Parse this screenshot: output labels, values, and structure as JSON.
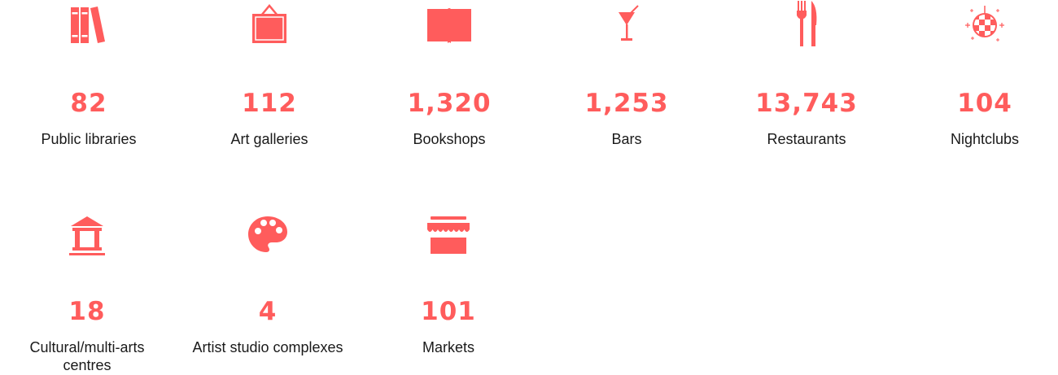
{
  "accent_color": "#ff5c5c",
  "stats": [
    {
      "icon": "books-icon",
      "value": "82",
      "label": "Public libraries"
    },
    {
      "icon": "picture-frame-icon",
      "value": "112",
      "label": "Art galleries"
    },
    {
      "icon": "open-book-icon",
      "value": "1,320",
      "label": "Bookshops"
    },
    {
      "icon": "cocktail-glass-icon",
      "value": "1,253",
      "label": "Bars"
    },
    {
      "icon": "fork-knife-icon",
      "value": "13,743",
      "label": "Restaurants"
    },
    {
      "icon": "disco-ball-icon",
      "value": "104",
      "label": "Nightclubs"
    },
    {
      "icon": "museum-building-icon",
      "value": "18",
      "label": "Cultural/multi-arts centres"
    },
    {
      "icon": "paint-palette-icon",
      "value": "4",
      "label": "Artist studio complexes"
    },
    {
      "icon": "market-stall-icon",
      "value": "101",
      "label": "Markets"
    }
  ]
}
